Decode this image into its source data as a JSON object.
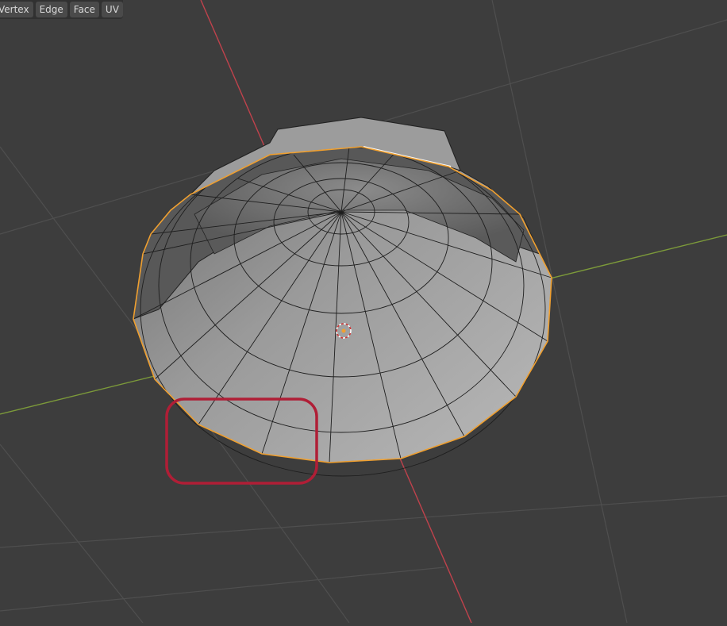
{
  "header": {
    "menu_items": [
      {
        "label": "Vertex"
      },
      {
        "label": "Edge"
      },
      {
        "label": "Face"
      },
      {
        "label": "UV"
      }
    ]
  },
  "viewport": {
    "mode": "Edit Mode",
    "background_color": "#3d3d3d",
    "grid_color": "#555555",
    "x_axis_color": "#c0424c",
    "y_axis_color": "#7c9a3a",
    "selection_outline_color": "#f0a030",
    "mesh_face_color": "#a8a8a8",
    "highlight_box_color": "#b01e36",
    "icons": [
      "3d-cursor-icon",
      "origin-dot-icon"
    ]
  }
}
